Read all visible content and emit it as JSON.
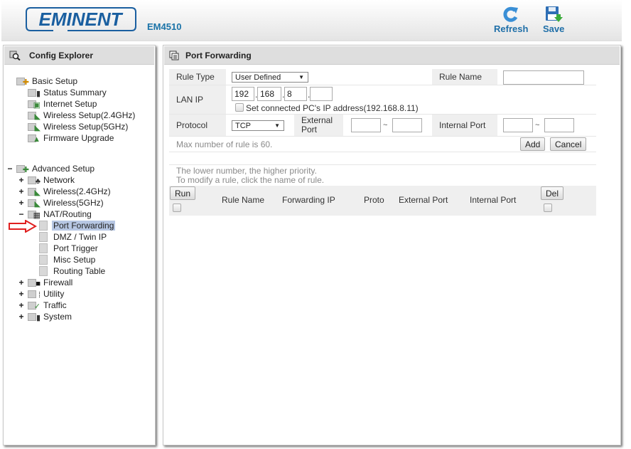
{
  "header": {
    "brand": "EMINENT",
    "model": "EM4510",
    "refresh_label": "Refresh",
    "save_label": "Save",
    "brand_color": "#1a5fa0"
  },
  "sidebar": {
    "title": "Config Explorer",
    "basic_setup": {
      "label": "Basic Setup",
      "items": [
        "Status Summary",
        "Internet Setup",
        "Wireless Setup(2.4GHz)",
        "Wireless Setup(5GHz)",
        "Firmware Upgrade"
      ]
    },
    "advanced_setup": {
      "label": "Advanced Setup",
      "toggle": "−",
      "groups": [
        {
          "label": "Network",
          "toggle": "+"
        },
        {
          "label": "Wireless(2.4GHz)",
          "toggle": "+"
        },
        {
          "label": "Wireless(5GHz)",
          "toggle": "+"
        },
        {
          "label": "NAT/Routing",
          "toggle": "−",
          "children": [
            "Port Forwarding",
            "DMZ / Twin IP",
            "Port Trigger",
            "Misc Setup",
            "Routing Table"
          ],
          "selected": "Port Forwarding"
        },
        {
          "label": "Firewall",
          "toggle": "+"
        },
        {
          "label": "Utility",
          "toggle": "+"
        },
        {
          "label": "Traffic",
          "toggle": "+"
        },
        {
          "label": "System",
          "toggle": "+"
        }
      ]
    }
  },
  "main": {
    "title": "Port Forwarding",
    "form": {
      "rule_type_label": "Rule Type",
      "rule_type_value": "User Defined",
      "rule_name_label": "Rule Name",
      "rule_name_value": "",
      "lan_ip_label": "LAN IP",
      "lan_ip": [
        "192",
        "168",
        "8",
        ""
      ],
      "set_pc_ip_label": "Set connected PC's IP address(192.168.8.11)",
      "protocol_label": "Protocol",
      "protocol_value": "TCP",
      "external_port_label": "External Port",
      "internal_port_label": "Internal Port",
      "range_sep": "~",
      "max_rules_note": "Max number of rule is 60.",
      "add_label": "Add",
      "cancel_label": "Cancel"
    },
    "notes": [
      "The lower number, the higher priority.",
      "To modify a rule, click the name of rule."
    ],
    "table": {
      "run_label": "Run",
      "del_label": "Del",
      "columns": [
        "Rule Name",
        "Forwarding IP",
        "Proto",
        "External Port",
        "Internal Port"
      ],
      "rows": []
    }
  }
}
